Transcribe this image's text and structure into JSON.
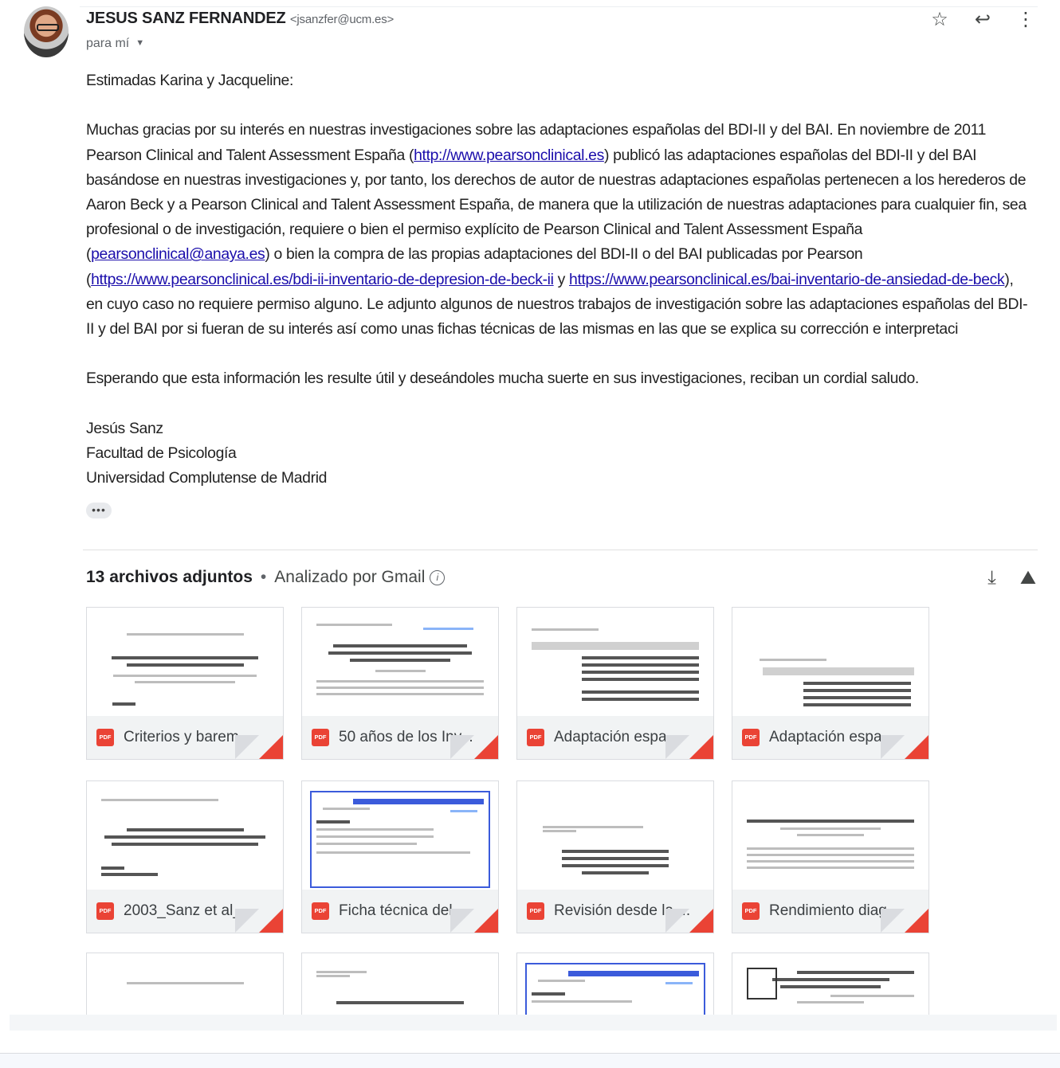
{
  "message": {
    "sender_name": "JESUS SANZ FERNANDEZ",
    "sender_email": "<jsanzfer@ucm.es>",
    "to_label": "para mí",
    "actions": {
      "star": "☆",
      "reply": "↩",
      "more": "⋮"
    },
    "greeting": "Estimadas Karina y Jacqueline:",
    "para1": {
      "t1": "Muchas gracias por su interés en nuestras investigaciones sobre las adaptaciones españolas del BDI-II y del BAI. En noviembre de 2011 Pearson Clinical and Talent Assessment España (",
      "link1": "http://www.pearsonclinical.es",
      "t2": ") publicó las adaptaciones españolas del BDI-II y del BAI basándose en nuestras investigaciones y, por tanto, los derechos de autor de nuestras adaptaciones españolas pertenecen a los herederos de Aaron Beck y a Pearson Clinical and Talent Assessment España, de manera que la utilización de nuestras adaptaciones para cualquier fin, sea profesional o de investigación, requiere o bien el permiso explícito de Pearson Clinical and Talent Assessment España (",
      "link2": "pearsonclinical@anaya.es",
      "t3": ") o bien la compra de las propias adaptaciones del BDI-II o del BAI publicadas por Pearson (",
      "link3": "https://www.pearsonclinical.es/bdi-ii-inventario-de-depresion-de-beck-ii",
      "t4": " y ",
      "link4": "https://www.pearsonclinical.es/bai-inventario-de-ansiedad-de-beck",
      "t5": "), en cuyo caso no requiere permiso alguno. Le adjunto algunos de nuestros trabajos de investigación sobre las adaptaciones españolas del BDI-II y del BAI por si fueran de su interés así como unas fichas técnicas de las mismas en las que se explica su corrección e interpretaci"
    },
    "para2": "Esperando que esta información les resulte útil y deseándoles mucha suerte en sus investigaciones, reciban un cordial saludo.",
    "signature": {
      "name": "Jesús Sanz",
      "faculty": "Facultad de Psicología",
      "university": "Universidad Complutense de Madrid"
    },
    "show_trimmed": "•••"
  },
  "attachments": {
    "count_label": "13 archivos adjuntos",
    "separator": "•",
    "scan_label": "Analizado por Gmail",
    "info_icon": "i",
    "download_icon": "⤓",
    "drive_icon": "⛰",
    "pdf_badge": "PDF",
    "files": [
      "Criterios y barem...",
      "50 años de los Inv...",
      "Adaptación espa...",
      "Adaptación espa...",
      "2003_Sanz et al_...",
      "Ficha técnica del ...",
      "Revisión desde la ...",
      "Rendimiento diag..."
    ]
  }
}
